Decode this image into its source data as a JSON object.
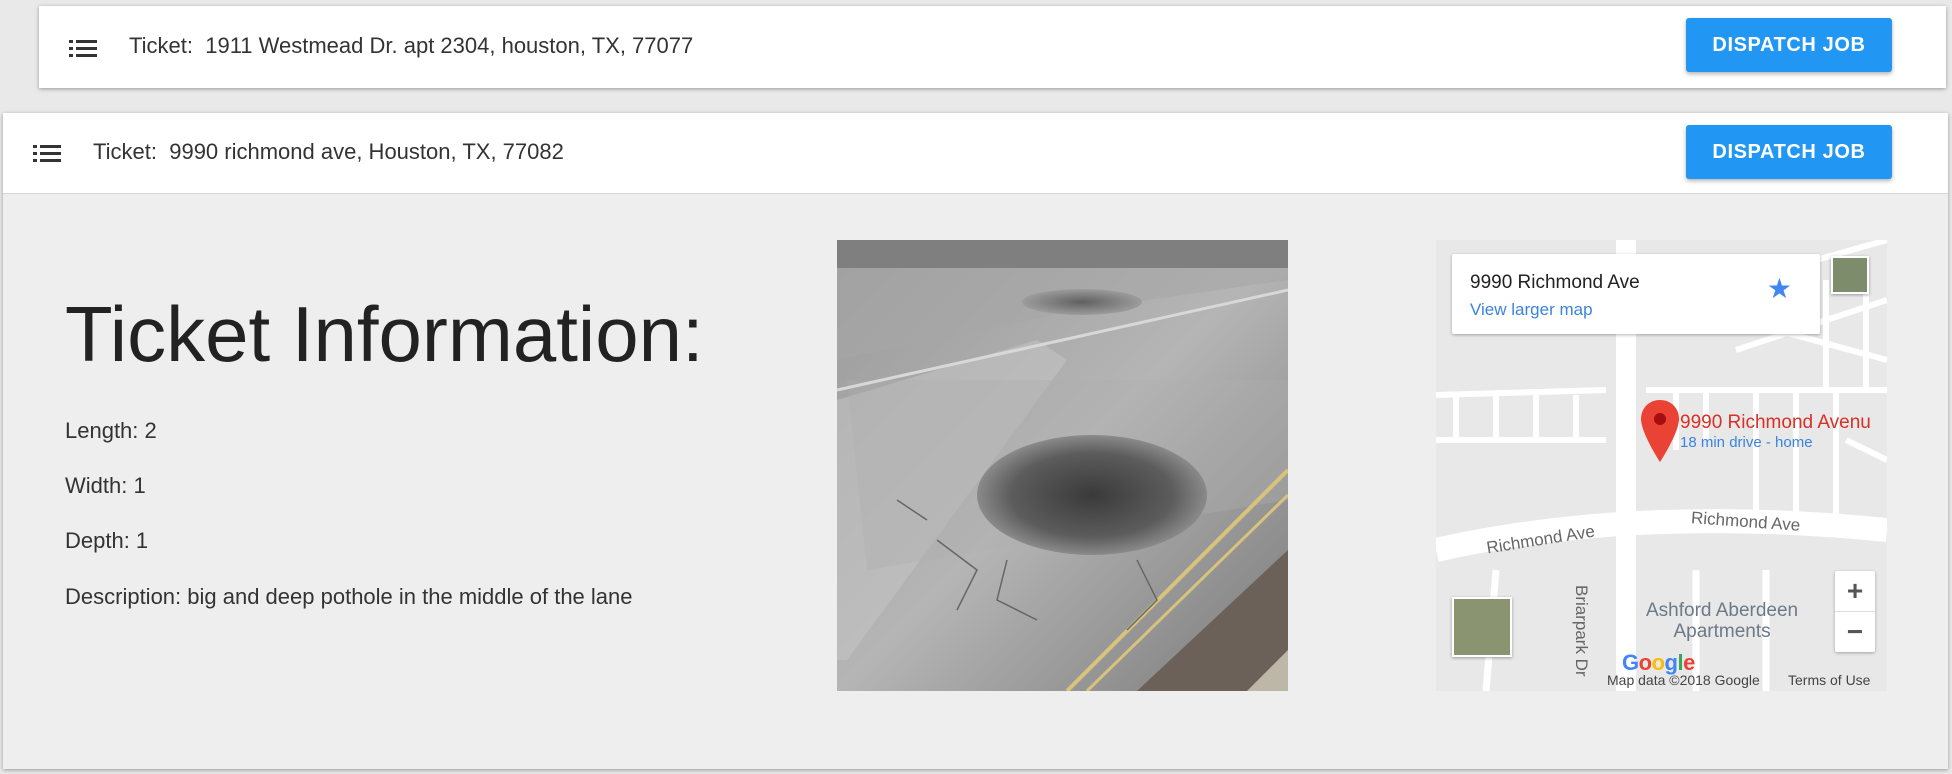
{
  "tickets": [
    {
      "label": "Ticket:",
      "address": "1911 Westmead Dr. apt 2304, houston, TX, 77077",
      "dispatch_label": "DISPATCH JOB"
    },
    {
      "label": "Ticket:",
      "address": "9990 richmond ave, Houston, TX, 77082",
      "dispatch_label": "DISPATCH JOB",
      "info": {
        "title": "Ticket Information:",
        "length": "Length: 2",
        "width": "Width: 1",
        "depth": "Depth: 1",
        "description": "Description: big and deep pothole in the middle of the lane"
      },
      "map": {
        "place_name": "9990 Richmond Ave",
        "view_larger": "View larger map",
        "pin_label": "9990 Richmond Avenu",
        "pin_sub": "18 min drive - home",
        "road_richmond_left": "Richmond Ave",
        "road_richmond_right": "Richmond Ave",
        "road_briarpark": "Briarpark Dr",
        "poi_line1": "Ashford Aberdeen",
        "poi_line2": "Apartments",
        "zoom_in": "+",
        "zoom_out": "−",
        "map_data": "Map data ©2018 Google",
        "terms": "Terms of Use",
        "logo": "Google"
      }
    }
  ],
  "colors": {
    "accent": "#2196f3",
    "pin": "#ea4335",
    "link": "#3a84df"
  },
  "icons": {
    "list": "list-icon",
    "star": "star-icon",
    "pin": "map-pin-icon"
  }
}
